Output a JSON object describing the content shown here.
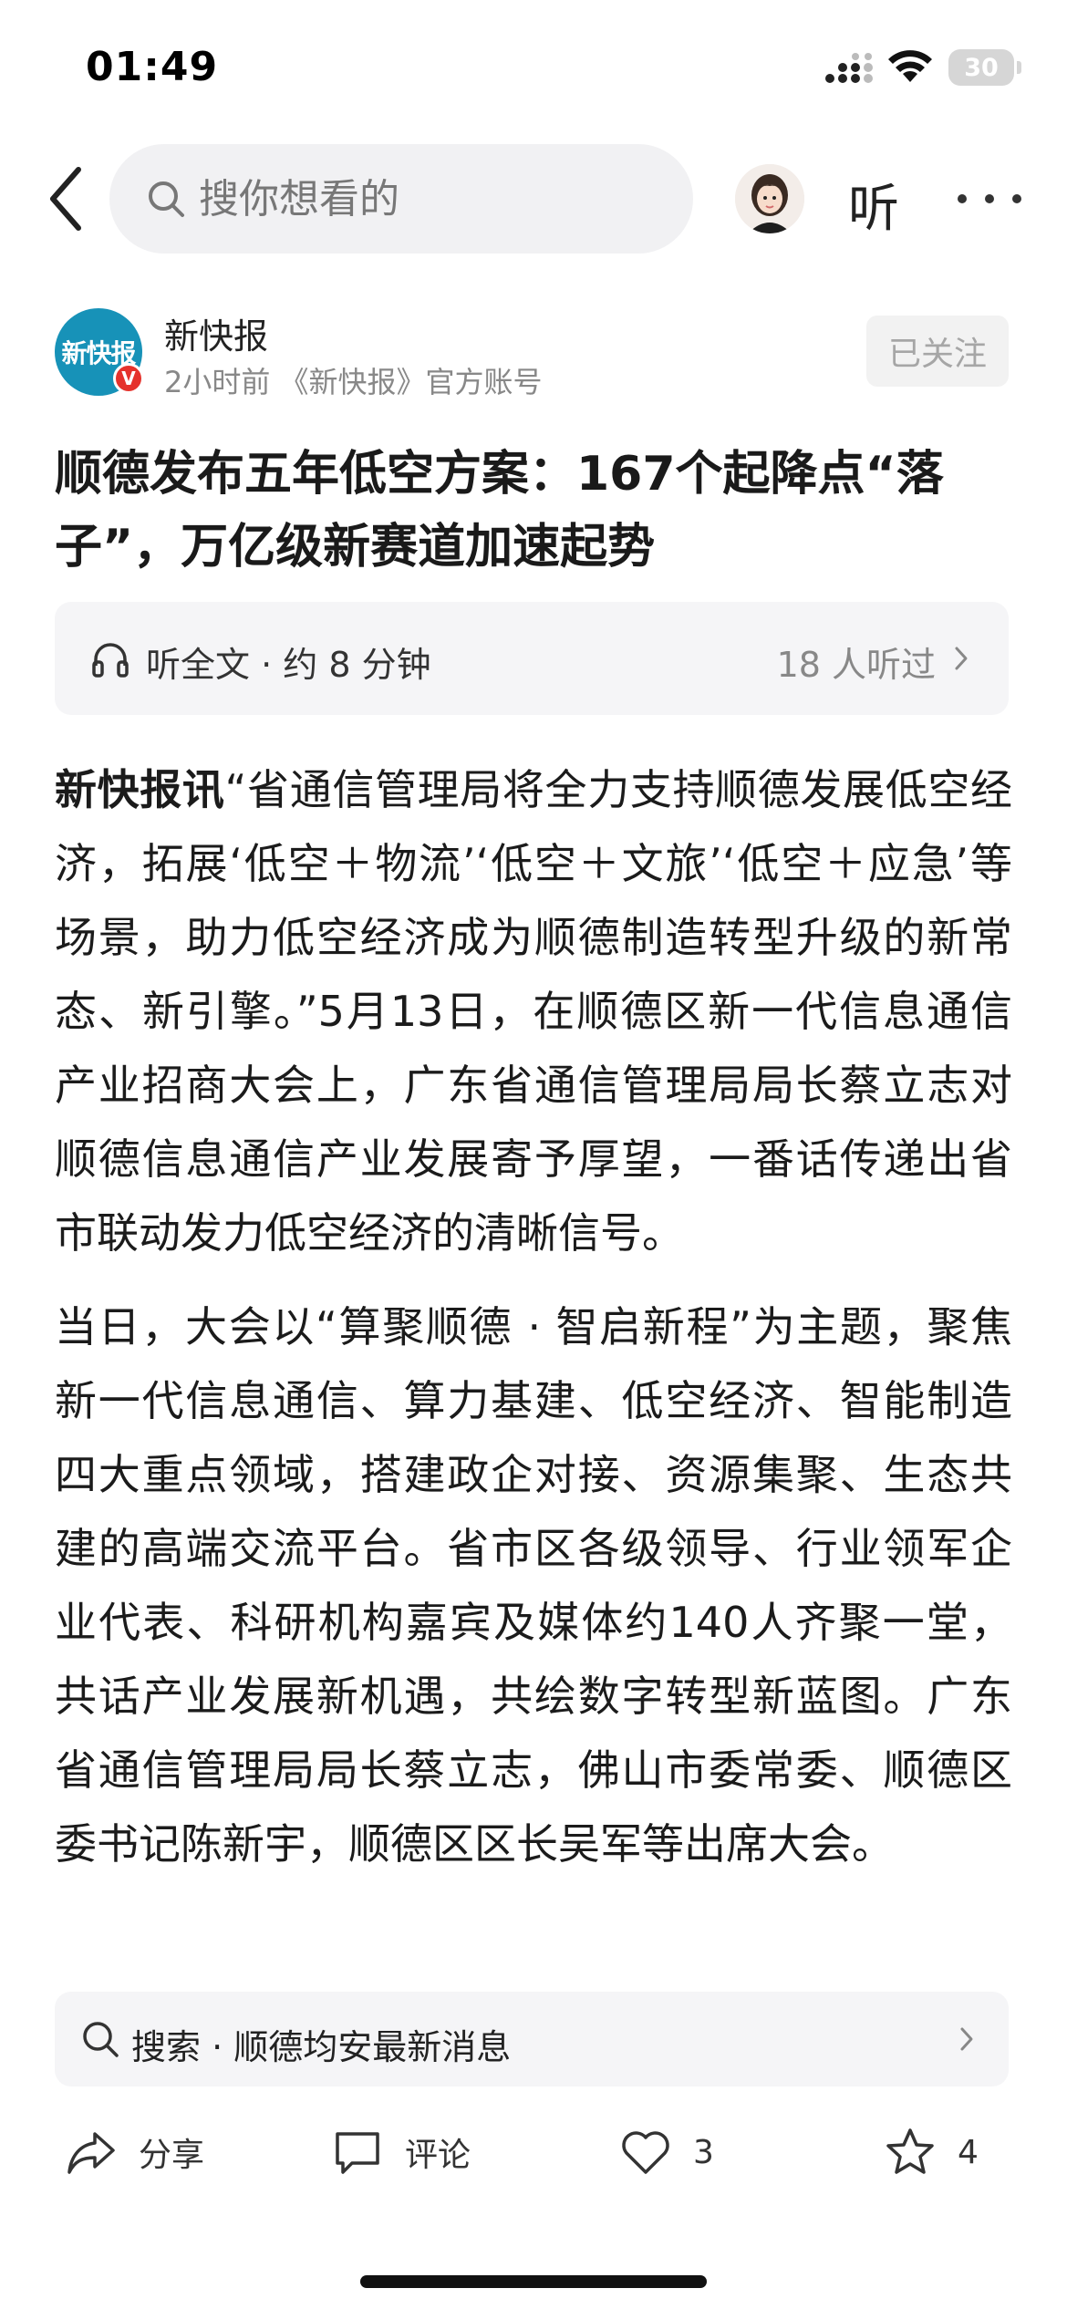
{
  "status_bar": {
    "time": "01:49",
    "battery": "30"
  },
  "search": {
    "placeholder": "搜你想看的"
  },
  "header": {
    "listen_label": "听"
  },
  "publisher": {
    "logo_text": "新快报",
    "name": "新快报",
    "meta": "2小时前 《新快报》官方账号",
    "follow_label": "已关注"
  },
  "article": {
    "title": "顺德发布五年低空方案：167个起降点“落子”，万亿级新赛道加速起势",
    "listen_text": "听全文 · 约 8 分钟",
    "listen_count": "18 人听过",
    "paragraph1_lead": "新快报讯",
    "paragraph1": "“省通信管理局将全力支持顺德发展低空经济，拓展‘低空＋物流’‘低空＋文旅’‘低空＋应急’等场景，助力低空经济成为顺德制造转型升级的新常态、新引擎。”5月13日，在顺德区新一代信息通信产业招商大会上，广东省通信管理局局长蔡立志对顺德信息通信产业发展寄予厚望，一番话传递出省市联动发力低空经济的清晰信号。",
    "paragraph2": "当日，大会以“算聚顺德 · 智启新程”为主题，聚焦新一代信息通信、算力基建、低空经济、智能制造四大重点领域，搭建政企对接、资源集聚、生态共建的高端交流平台。省市区各级领导、行业领军企业代表、科研机构嘉宾及媒体约140人齐聚一堂，共话产业发展新机遇，共绘数字转型新蓝图。广东省通信管理局局长蔡立志，佛山市委常委、顺德区委书记陈新宇，顺德区区长吴军等出席大会。"
  },
  "suggestion": {
    "text": "搜索 · 顺德均安最新消息"
  },
  "bottom_bar": {
    "share_label": "分享",
    "comment_label": "评论",
    "like_count": "3",
    "favorite_count": "4"
  }
}
